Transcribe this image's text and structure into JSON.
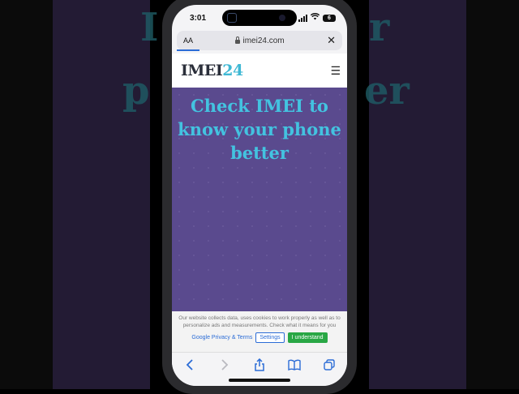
{
  "background": {
    "left_fragment": "I",
    "right_fragment": "r",
    "left_fragment_2": "p",
    "right_fragment_2": "er"
  },
  "status_bar": {
    "time": "3:01",
    "battery": "6"
  },
  "browser": {
    "aa_label": "AA",
    "url": "imei24.com",
    "close_icon": "close-icon"
  },
  "site": {
    "logo_part1": "IMEI",
    "logo_part2": "24",
    "menu_icon": "hamburger-icon",
    "hero_title": "Check IMEI to know your phone better"
  },
  "cookie_banner": {
    "text": "Our website collects data, uses cookies to work properly as well as to personalize ads and measurements. Check what it means for you",
    "privacy_link": "Google Privacy & Terms",
    "settings_label": "Settings",
    "accept_label": "I understand"
  },
  "toolbar": {
    "items": [
      "back-icon",
      "forward-icon",
      "share-icon",
      "bookmarks-icon",
      "tabs-icon"
    ]
  },
  "colors": {
    "hero_bg": "#5a4a8e",
    "hero_text": "#43c3e0",
    "accent_blue": "#2b6cd6",
    "accept_green": "#29a745"
  }
}
